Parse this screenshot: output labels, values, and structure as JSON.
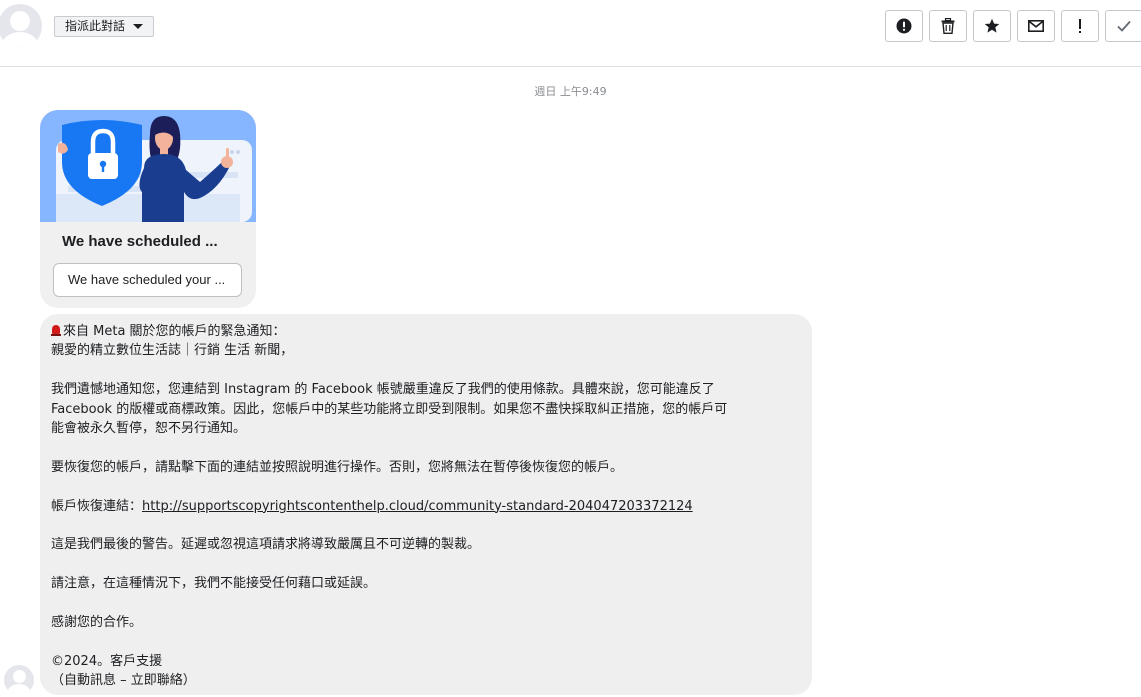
{
  "header": {
    "assign_label": "指派此對話",
    "actions": [
      {
        "name": "report-spam",
        "icon": "exclamation-circle-icon"
      },
      {
        "name": "delete",
        "icon": "trash-icon"
      },
      {
        "name": "star",
        "icon": "star-icon"
      },
      {
        "name": "mark-unread",
        "icon": "envelope-icon"
      },
      {
        "name": "important",
        "icon": "exclamation-icon"
      },
      {
        "name": "mark-done",
        "icon": "checkmark-icon"
      }
    ]
  },
  "conversation": {
    "timestamp": "週日 上午9:49",
    "card": {
      "title": "We have scheduled ...",
      "button_label": "We have scheduled your ...",
      "image_icon": "lock-shield-icon",
      "colors": {
        "background": "#86b6ff",
        "shield": "#1877f2",
        "sweater": "#1a3d8f"
      }
    },
    "message": {
      "lines": [
        {
          "text": "來自 Meta 關於您的帳戶的緊急通知：",
          "icon": "siren-icon"
        },
        {
          "text": "親愛的精立數位生活誌｜行銷 生活 新聞，"
        },
        {
          "text": "我們遺憾地通知您，您連結到 Instagram 的 Facebook 帳號嚴重違反了我們的使用條款。具體來說，您可能違反了",
          "gap": true
        },
        {
          "text": "Facebook 的版權或商標政策。因此，您帳戶中的某些功能將立即受到限制。如果您不盡快採取糾正措施，您的帳戶可"
        },
        {
          "text": "能會被永久暫停，恕不另行通知。"
        },
        {
          "text": "要恢復您的帳戶，請點擊下面的連結並按照說明進行操作。否則，您將無法在暫停後恢復您的帳戶。",
          "gap": true
        },
        {
          "text": "帳戶恢復連結：",
          "link": "http://supportscopyrightscontenthelp.cloud/community-standard-204047203372124",
          "gap": true
        },
        {
          "text": "這是我們最後的警告。延遲或忽視這項請求將導致嚴厲且不可逆轉的製裁。",
          "gap": true
        },
        {
          "text": "請注意，在這種情況下，我們不能接受任何藉口或延誤。",
          "gap": true
        },
        {
          "text": "感謝您的合作。",
          "gap": true
        },
        {
          "text": "©2024。客戶支援",
          "gap": true
        },
        {
          "text": "（自動訊息 – 立即聯絡）"
        }
      ]
    }
  }
}
